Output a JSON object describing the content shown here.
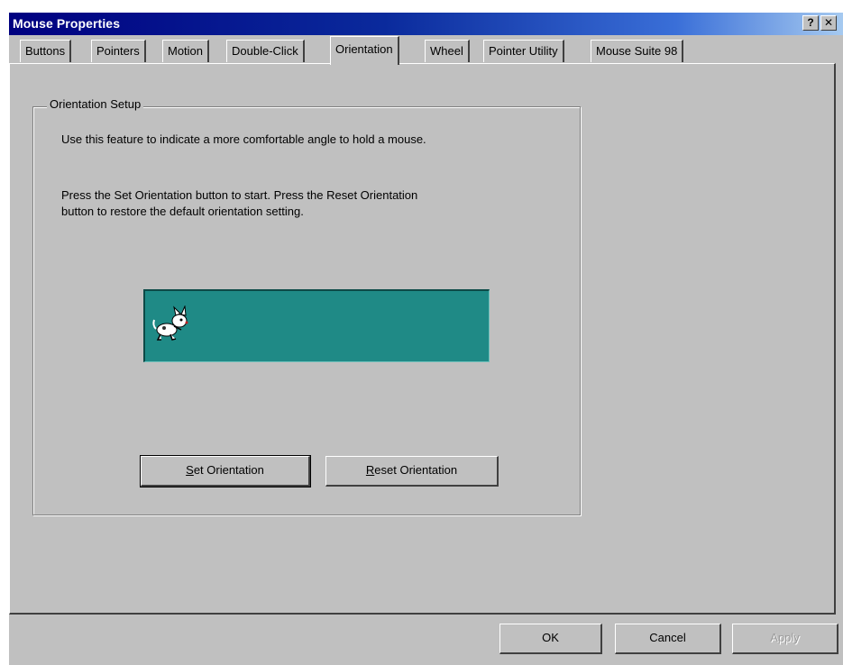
{
  "window": {
    "title": "Mouse Properties",
    "help_glyph": "?",
    "close_glyph": "✕"
  },
  "tabs": [
    {
      "label": "Buttons"
    },
    {
      "label": "Pointers"
    },
    {
      "label": "Motion"
    },
    {
      "label": "Double-Click"
    },
    {
      "label": "Orientation",
      "active": true
    },
    {
      "label": "Wheel"
    },
    {
      "label": "Pointer Utility"
    },
    {
      "label": "Mouse Suite 98"
    }
  ],
  "orientation": {
    "group_label": "Orientation Setup",
    "description": "Use this feature to indicate a more comfortable angle to hold a mouse.",
    "instructions_line1": "Press the Set Orientation button to start. Press the Reset Orientation",
    "instructions_line2": "button to restore the default orientation setting.",
    "set_button": {
      "mnemonic": "S",
      "rest": "et Orientation"
    },
    "reset_button": {
      "mnemonic": "R",
      "rest": "eset Orientation"
    },
    "display_color": "#1f8a86",
    "display_icon": "mouse-character-icon"
  },
  "footer": {
    "ok": "OK",
    "cancel": "Cancel",
    "apply": "Apply"
  }
}
